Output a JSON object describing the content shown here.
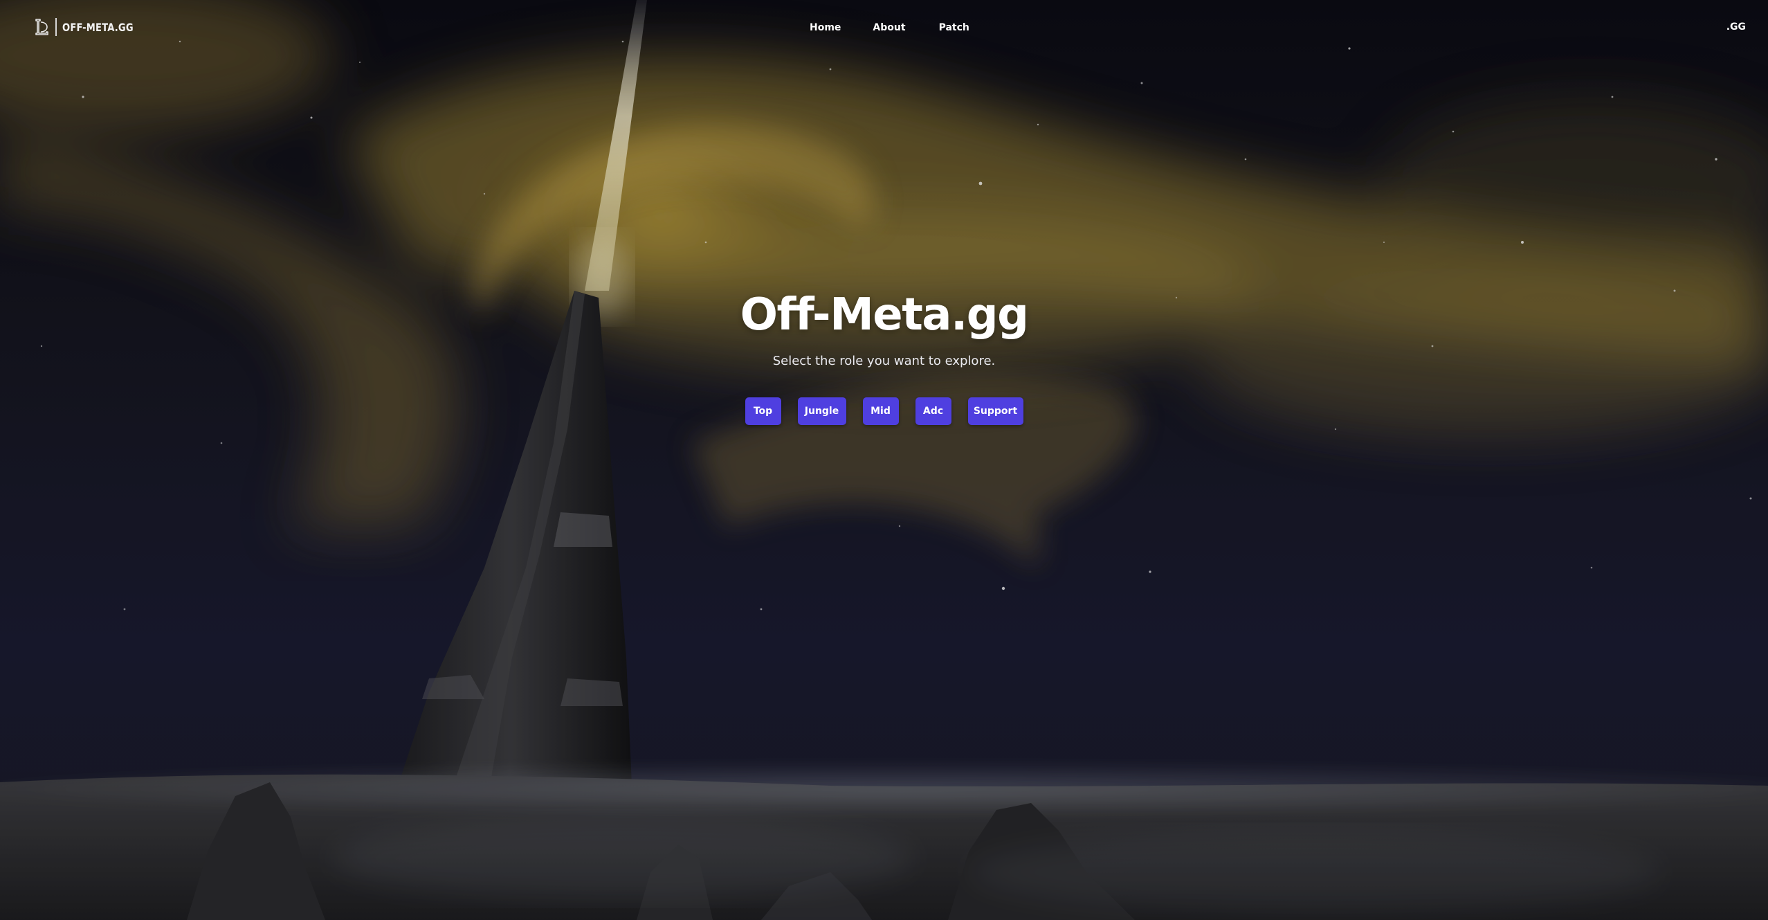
{
  "header": {
    "brand_name": "OFF-META.GG",
    "nav": {
      "home": "Home",
      "about": "About",
      "patch": "Patch"
    },
    "gg_label": ".GG"
  },
  "hero": {
    "title": "Off-Meta.gg",
    "subtitle": "Select the role you want to explore.",
    "roles": [
      "Top",
      "Jungle",
      "Mid",
      "Adc",
      "Support"
    ]
  },
  "colors": {
    "button_bg": "#4f3fe0",
    "text": "#ffffff",
    "aurora": "#c9a23a",
    "sky": "#14152a"
  },
  "icons": {
    "brand": "league-logo-icon"
  }
}
